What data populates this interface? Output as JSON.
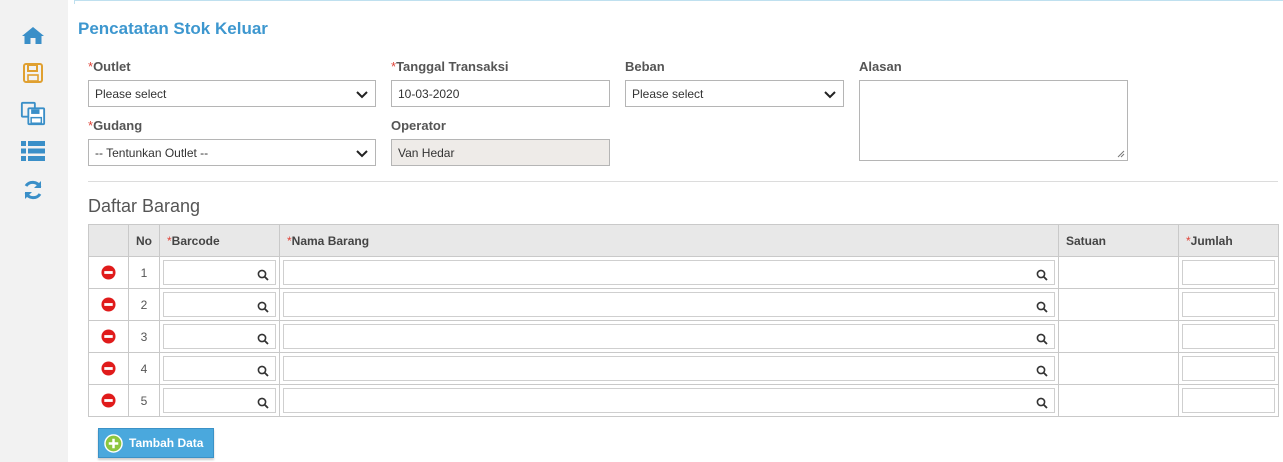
{
  "sidebar": {
    "icons": [
      "home-icon",
      "save-icon",
      "save-all-icon",
      "list-icon",
      "refresh-icon"
    ]
  },
  "page": {
    "title": "Pencatatan Stok Keluar"
  },
  "form": {
    "outlet": {
      "label": "Outlet",
      "value": "Please select"
    },
    "tanggal": {
      "label": "Tanggal Transaksi",
      "value": "10-03-2020"
    },
    "beban": {
      "label": "Beban",
      "value": "Please select"
    },
    "alasan": {
      "label": "Alasan",
      "value": ""
    },
    "gudang": {
      "label": "Gudang",
      "value": "-- Tentunkan Outlet --"
    },
    "operator": {
      "label": "Operator",
      "value": "Van Hedar"
    },
    "required_mark": "*"
  },
  "table": {
    "section_title": "Daftar Barang",
    "headers": {
      "no": "No",
      "barcode": "Barcode",
      "nama": "Nama Barang",
      "satuan": "Satuan",
      "jumlah": "Jumlah"
    },
    "rows": [
      "1",
      "2",
      "3",
      "4",
      "5"
    ]
  },
  "actions": {
    "add_label": "Tambah Data"
  },
  "colors": {
    "accent": "#3d97cf",
    "button": "#4aa8dd",
    "required": "#e0453a",
    "delete": "#e01b1b"
  }
}
